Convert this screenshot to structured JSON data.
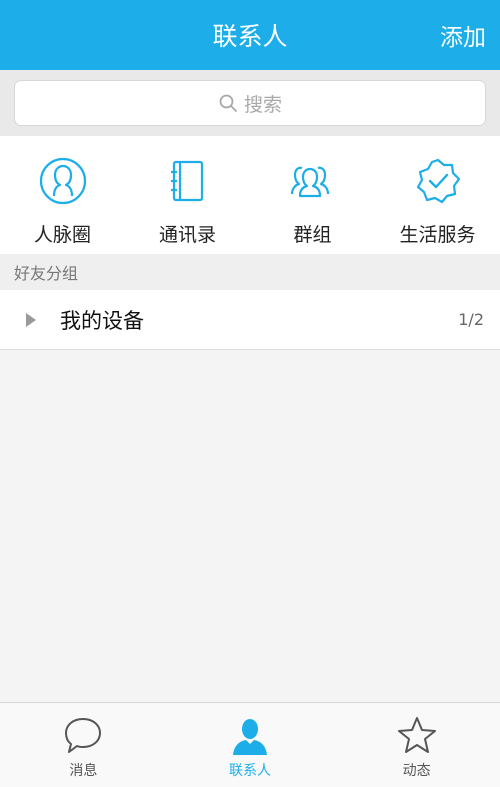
{
  "header": {
    "title": "联系人",
    "add_label": "添加"
  },
  "search": {
    "placeholder": "搜索",
    "icon": "search-icon"
  },
  "quick_actions": [
    {
      "label": "人脉圈",
      "icon": "person-circle-icon"
    },
    {
      "label": "通讯录",
      "icon": "address-book-icon"
    },
    {
      "label": "群组",
      "icon": "group-icon"
    },
    {
      "label": "生活服务",
      "icon": "badge-check-icon"
    }
  ],
  "friends_section": {
    "title": "好友分组",
    "groups": [
      {
        "name": "我的设备",
        "count": "1/2",
        "icon": "triangle-right-icon"
      }
    ]
  },
  "tabs": [
    {
      "label": "消息",
      "icon": "chat-bubble-icon",
      "active": false
    },
    {
      "label": "联系人",
      "icon": "contact-person-icon",
      "active": true
    },
    {
      "label": "动态",
      "icon": "star-icon",
      "active": false
    }
  ],
  "colors": {
    "accent": "#1daee9",
    "icon_inactive": "#555555",
    "background": "#f4f4f4"
  }
}
